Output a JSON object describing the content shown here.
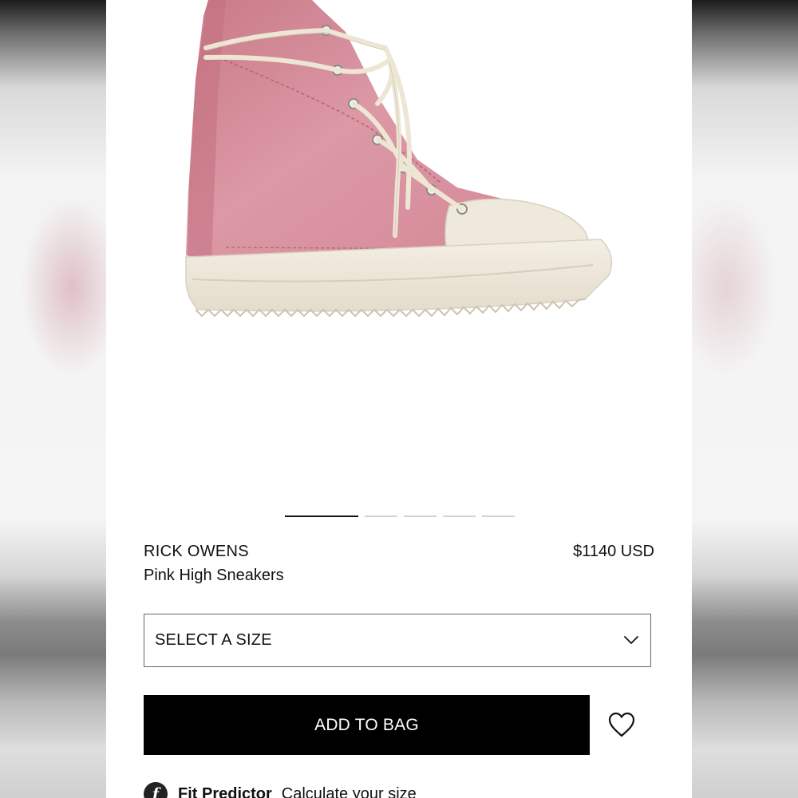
{
  "product": {
    "brand": "RICK OWENS",
    "name": "Pink High Sneakers",
    "price": "$1140 USD",
    "colors": {
      "upper": "#d88c9a",
      "sole": "#efe9dc",
      "laces": "#eee6d4"
    }
  },
  "carousel": {
    "total_images": 5,
    "active_index": 0
  },
  "size_select": {
    "label": "SELECT A SIZE",
    "icon": "chevron-down-icon"
  },
  "actions": {
    "add_to_bag_label": "ADD TO BAG",
    "wishlist_icon": "heart-icon"
  },
  "fit_predictor": {
    "logo_letter": "f",
    "title": "Fit Predictor",
    "cta": "Calculate your size"
  }
}
